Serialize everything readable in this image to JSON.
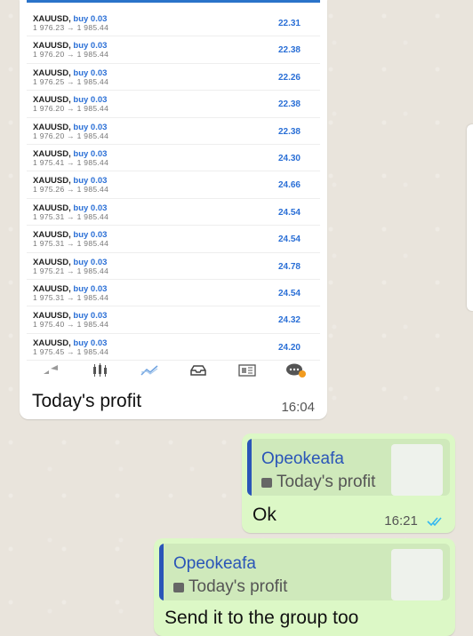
{
  "trades": [
    {
      "symbol": "XAUUSD,",
      "direction": "buy 0.03",
      "prices": "1 976.23 → 1 985.44",
      "profit": "22.31"
    },
    {
      "symbol": "XAUUSD,",
      "direction": "buy 0.03",
      "prices": "1 976.20 → 1 985.44",
      "profit": "22.38"
    },
    {
      "symbol": "XAUUSD,",
      "direction": "buy 0.03",
      "prices": "1 976.25 → 1 985.44",
      "profit": "22.26"
    },
    {
      "symbol": "XAUUSD,",
      "direction": "buy 0.03",
      "prices": "1 976.20 → 1 985.44",
      "profit": "22.38"
    },
    {
      "symbol": "XAUUSD,",
      "direction": "buy 0.03",
      "prices": "1 976.20 → 1 985.44",
      "profit": "22.38"
    },
    {
      "symbol": "XAUUSD,",
      "direction": "buy 0.03",
      "prices": "1 975.41 → 1 985.44",
      "profit": "24.30"
    },
    {
      "symbol": "XAUUSD,",
      "direction": "buy 0.03",
      "prices": "1 975.26 → 1 985.44",
      "profit": "24.66"
    },
    {
      "symbol": "XAUUSD,",
      "direction": "buy 0.03",
      "prices": "1 975.31 → 1 985.44",
      "profit": "24.54"
    },
    {
      "symbol": "XAUUSD,",
      "direction": "buy 0.03",
      "prices": "1 975.31 → 1 985.44",
      "profit": "24.54"
    },
    {
      "symbol": "XAUUSD,",
      "direction": "buy 0.03",
      "prices": "1 975.21 → 1 985.44",
      "profit": "24.78"
    },
    {
      "symbol": "XAUUSD,",
      "direction": "buy 0.03",
      "prices": "1 975.31 → 1 985.44",
      "profit": "24.54"
    },
    {
      "symbol": "XAUUSD,",
      "direction": "buy 0.03",
      "prices": "1 975.40 → 1 985.44",
      "profit": "24.32"
    },
    {
      "symbol": "XAUUSD,",
      "direction": "buy 0.03",
      "prices": "1 975.45 → 1 985.44",
      "profit": "24.20"
    }
  ],
  "tabbar_icons": [
    "quotes-icon",
    "chart-icon",
    "trade-icon",
    "history-icon",
    "news-icon",
    "messages-icon"
  ],
  "incoming_message": {
    "caption": "Today's profit",
    "time": "16:04"
  },
  "reply1": {
    "quote_author": "Opeokeafa",
    "quote_text": "Today's profit",
    "text": "Ok",
    "time": "16:21"
  },
  "reply2": {
    "quote_author": "Opeokeafa",
    "quote_text": "Today's profit",
    "text": "Send it to the group too"
  },
  "colors": {
    "accent": "#2a6fd6",
    "outgoing_bubble": "#dcf8c6",
    "read_ticks": "#34b7f1",
    "quote_bar": "#2a55b8"
  }
}
